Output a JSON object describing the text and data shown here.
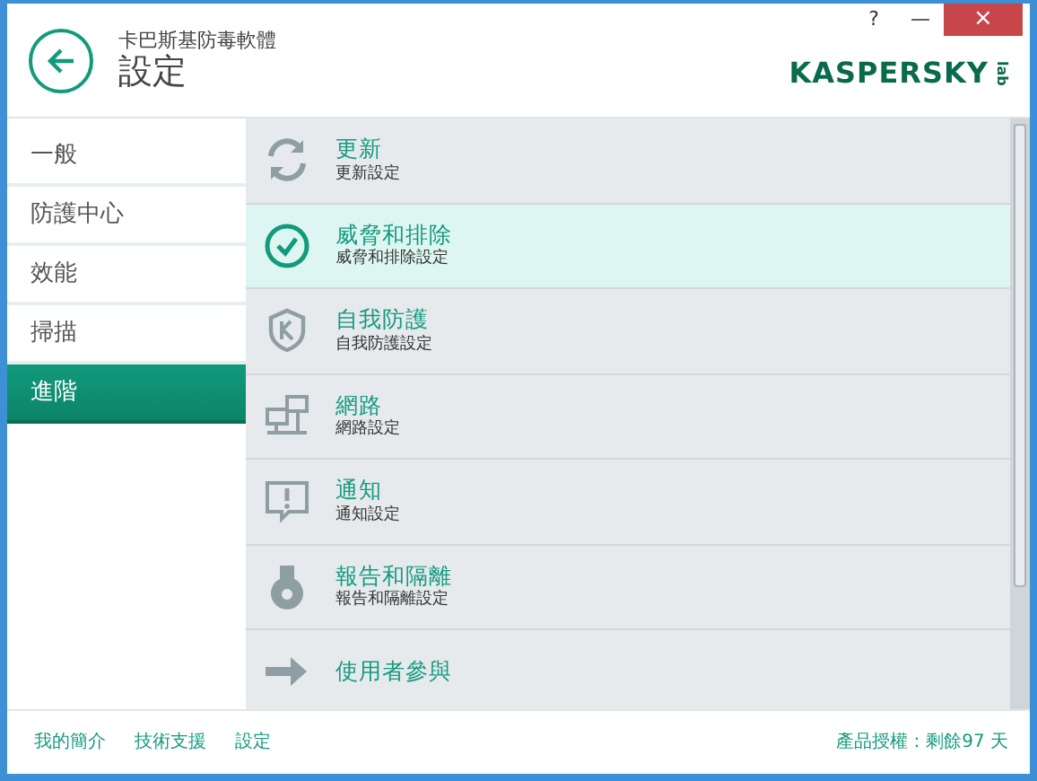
{
  "window": {
    "app_name": "卡巴斯基防毒軟體",
    "title": "設定",
    "logo": "KASPERSKY",
    "logo_suffix": "lab",
    "controls": [
      "?",
      "—",
      "×"
    ]
  },
  "sidebar": {
    "items": [
      {
        "label": "一般",
        "selected": false
      },
      {
        "label": "防護中心",
        "selected": false
      },
      {
        "label": "效能",
        "selected": false
      },
      {
        "label": "掃描",
        "selected": false
      },
      {
        "label": "進階",
        "selected": true
      }
    ]
  },
  "settings": [
    {
      "kind": "refresh",
      "title": "更新",
      "subtitle": "更新設定",
      "highlighted": false
    },
    {
      "kind": "check",
      "title": "威脅和排除",
      "subtitle": "威脅和排除設定",
      "highlighted": true
    },
    {
      "kind": "shield",
      "title": "自我防護",
      "subtitle": "自我防護設定",
      "highlighted": false
    },
    {
      "kind": "network",
      "title": "網路",
      "subtitle": "網路設定",
      "highlighted": false
    },
    {
      "kind": "alert",
      "title": "通知",
      "subtitle": "通知設定",
      "highlighted": false
    },
    {
      "kind": "flask",
      "title": "報告和隔離",
      "subtitle": "報告和隔離設定",
      "highlighted": false
    },
    {
      "kind": "arrow",
      "title": "使用者參與",
      "highlighted": false
    }
  ],
  "footer": {
    "links": [
      "我的簡介",
      "技術支援",
      "設定"
    ],
    "license": "產品授權：剩餘97 天"
  }
}
